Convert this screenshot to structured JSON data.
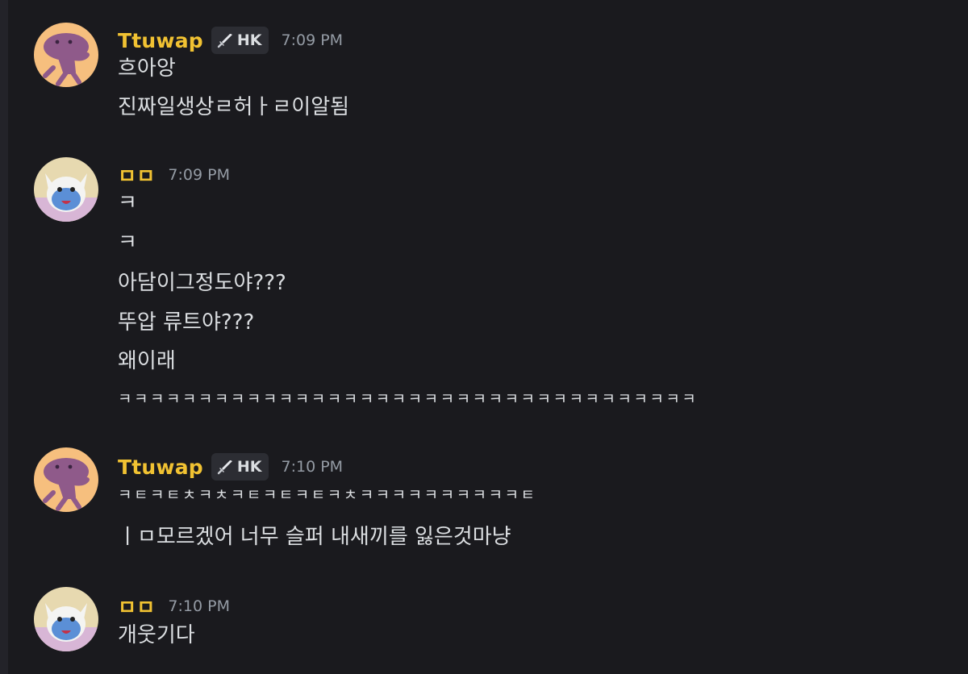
{
  "messages": [
    {
      "author": "Ttuwap",
      "tag": "HK",
      "time": "7:09 PM",
      "lines": [
        "흐아앙",
        "진짜일생상ㄹ허ㅏㄹ이알됨"
      ]
    },
    {
      "author": "ㅁㅁ",
      "time": "7:09 PM",
      "lines": [
        "ㅋ",
        "ㅋ",
        "아담이그정도야???",
        "뚜압 류트야???",
        "왜이래",
        "ㅋㅋㅋㅋㅋㅋㅋㅋㅋㅋㅋㅋㅋㅋㅋㅋㅋㅋㅋㅋㅋㅋㅋㅋㅋㅋㅋㅋㅋㅋㅋㅋㅋㅋㅋㅋ"
      ]
    },
    {
      "author": "Ttuwap",
      "tag": "HK",
      "time": "7:10 PM",
      "lines": [
        "ㅋㅌㅋㅌㅊㅋㅊㅋㅌㅋㅌㅋㅌㅋㅊㅋㅋㅋㅋㅋㅋㅋㅋㅋㅋㅌ",
        "ㅣㅁ모르겠어 너무 슬퍼 내새끼를 잃은것마냥"
      ]
    },
    {
      "author": "ㅁㅁ",
      "time": "7:10 PM",
      "lines": [
        "개웃기다"
      ]
    }
  ],
  "colors": {
    "background": "#1a1a1e",
    "username": "#f1c232",
    "text": "#dbdee1",
    "timestamp": "#949ba4",
    "tag_bg": "#2c2d33"
  },
  "icons": {
    "tag": "sword-icon"
  }
}
